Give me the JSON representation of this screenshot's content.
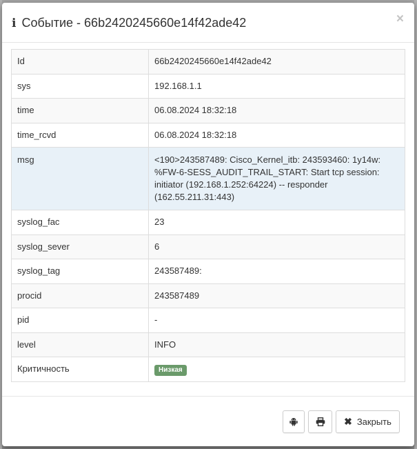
{
  "modal": {
    "title": "Событие - 66b2420245660e14f42ade42",
    "close_glyph": "×"
  },
  "rows": [
    {
      "key": "Id",
      "value": "66b2420245660e14f42ade42"
    },
    {
      "key": "sys",
      "value": "192.168.1.1"
    },
    {
      "key": "time",
      "value": "06.08.2024 18:32:18"
    },
    {
      "key": "time_rcvd",
      "value": "06.08.2024 18:32:18"
    },
    {
      "key": "msg",
      "value": "<190>243587489: Cisco_Kernel_itb: 243593460: 1y14w: %FW-6-SESS_AUDIT_TRAIL_START: Start tcp session: initiator (192.168.1.252:64224) -- responder (162.55.211.31:443)"
    },
    {
      "key": "syslog_fac",
      "value": "23"
    },
    {
      "key": "syslog_sever",
      "value": "6"
    },
    {
      "key": "syslog_tag",
      "value": "243587489:"
    },
    {
      "key": "procid",
      "value": "243587489"
    },
    {
      "key": "pid",
      "value": "-"
    },
    {
      "key": "level",
      "value": "INFO"
    },
    {
      "key": "Критичность",
      "badge": "Низкая",
      "badge_color": "#6a9a6a"
    }
  ],
  "footer": {
    "android_icon": "android-icon",
    "print_icon": "print-icon",
    "close_label": "Закрыть"
  }
}
